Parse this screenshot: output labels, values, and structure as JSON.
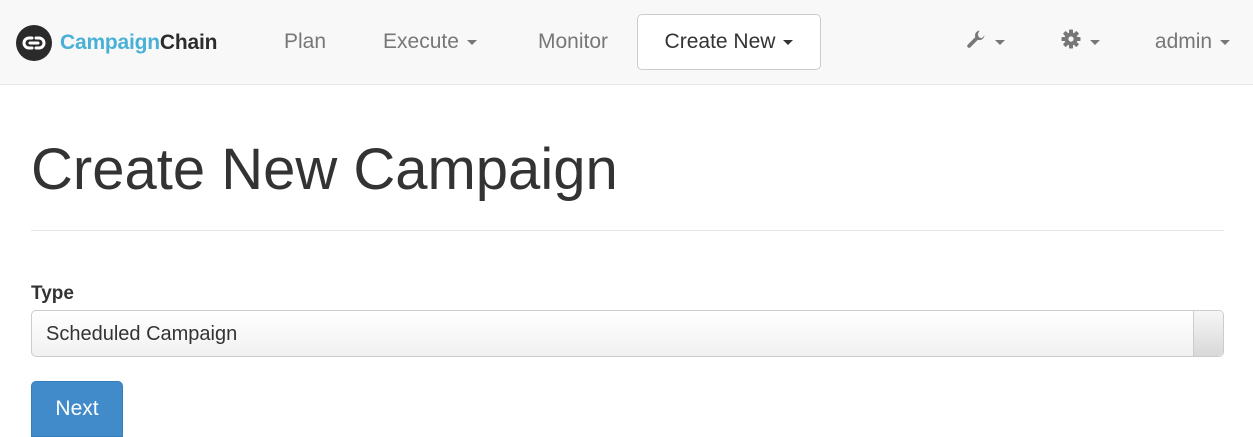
{
  "app": {
    "brand_part1": "Campaign",
    "brand_part2": "Chain",
    "logo_icon": "chain-link-icon"
  },
  "nav": {
    "plan": "Plan",
    "execute": "Execute",
    "monitor": "Monitor",
    "create_new": "Create New",
    "tools_icon": "wrench-icon",
    "settings_icon": "gear-icon",
    "user": "admin"
  },
  "page": {
    "title": "Create New Campaign"
  },
  "form": {
    "type_label": "Type",
    "type_value": "Scheduled Campaign",
    "next_button": "Next"
  },
  "colors": {
    "brand_accent": "#4ab1d6",
    "primary_button": "#428bca",
    "navbar_bg": "#f8f8f8"
  }
}
